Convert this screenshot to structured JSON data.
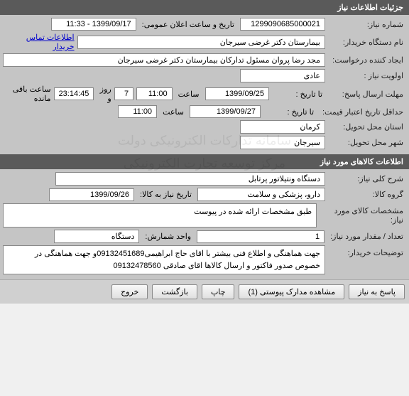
{
  "watermark": {
    "line1": "سامانه تدارکات الکترونیکی دولت",
    "line2": "مرکز توسعه تجارت الکترونیکی"
  },
  "section1": {
    "title": "جزئیات اطلاعات نیاز",
    "need_number_label": "شماره نیاز:",
    "need_number": "1299090685000021",
    "announce_label": "تاریخ و ساعت اعلان عمومی:",
    "announce_value": "1399/09/17 - 11:33",
    "buyer_org_label": "نام دستگاه خریدار:",
    "buyer_org": "بیمارستان دکتر غرضی سیرجان",
    "contact_link": "اطلاعات تماس خریدار",
    "creator_label": "ایجاد کننده درخواست:",
    "creator": "مجد رضا پروان مسئول تدارکان بیمارستان دکتر غرضی سیرجان",
    "priority_label": "اولویت نیاز :",
    "priority": "عادی",
    "deadline_label": "مهلت ارسال پاسخ:",
    "to_date_label": "تا تاریخ :",
    "deadline_date": "1399/09/25",
    "time_label": "ساعت",
    "deadline_time": "11:00",
    "remaining_days": "7",
    "days_label": "روز و",
    "remaining_time": "23:14:45",
    "remaining_label": "ساعت باقی مانده",
    "min_validity_label": "حداقل تاریخ اعتبار قیمت:",
    "min_validity_date": "1399/09/27",
    "min_validity_time": "11:00",
    "province_label": "استان محل تحویل:",
    "province": "کرمان",
    "city_label": "شهر محل تحویل:",
    "city": "سیرجان"
  },
  "section2": {
    "title": "اطلاعات کالاهای مورد نیاز",
    "desc_label": "شرح کلی نیاز:",
    "desc": "دستگاه ونتیلاتور پرتابل",
    "group_label": "گروه کالا:",
    "group": "دارو، پزشکی و سلامت",
    "date_need_label": "تاریخ نیاز به کالا:",
    "date_need": "1399/09/26",
    "specs_label": "مشخصات کالای مورد نیاز:",
    "specs": "طبق مشخصات ارائه شده در پیوست",
    "qty_label": "تعداد / مقدار مورد نیاز:",
    "qty": "1",
    "unit_label": "واحد شمارش:",
    "unit": "دستگاه",
    "buyer_notes_label": "توضیحات خریدار:",
    "buyer_notes": "جهت هماهنگی و اطلاع فنی بیشتر با اقای حاج ابراهیمی09132451689و جهت هماهنگی در خصوص صدور فاکتور و ارسال کالاها اقای صادقی 09132478560"
  },
  "buttons": {
    "respond": "پاسخ به نیاز",
    "attachments": "مشاهده مدارک پیوستی (1)",
    "print": "چاپ",
    "back": "بازگشت",
    "exit": "خروج"
  }
}
